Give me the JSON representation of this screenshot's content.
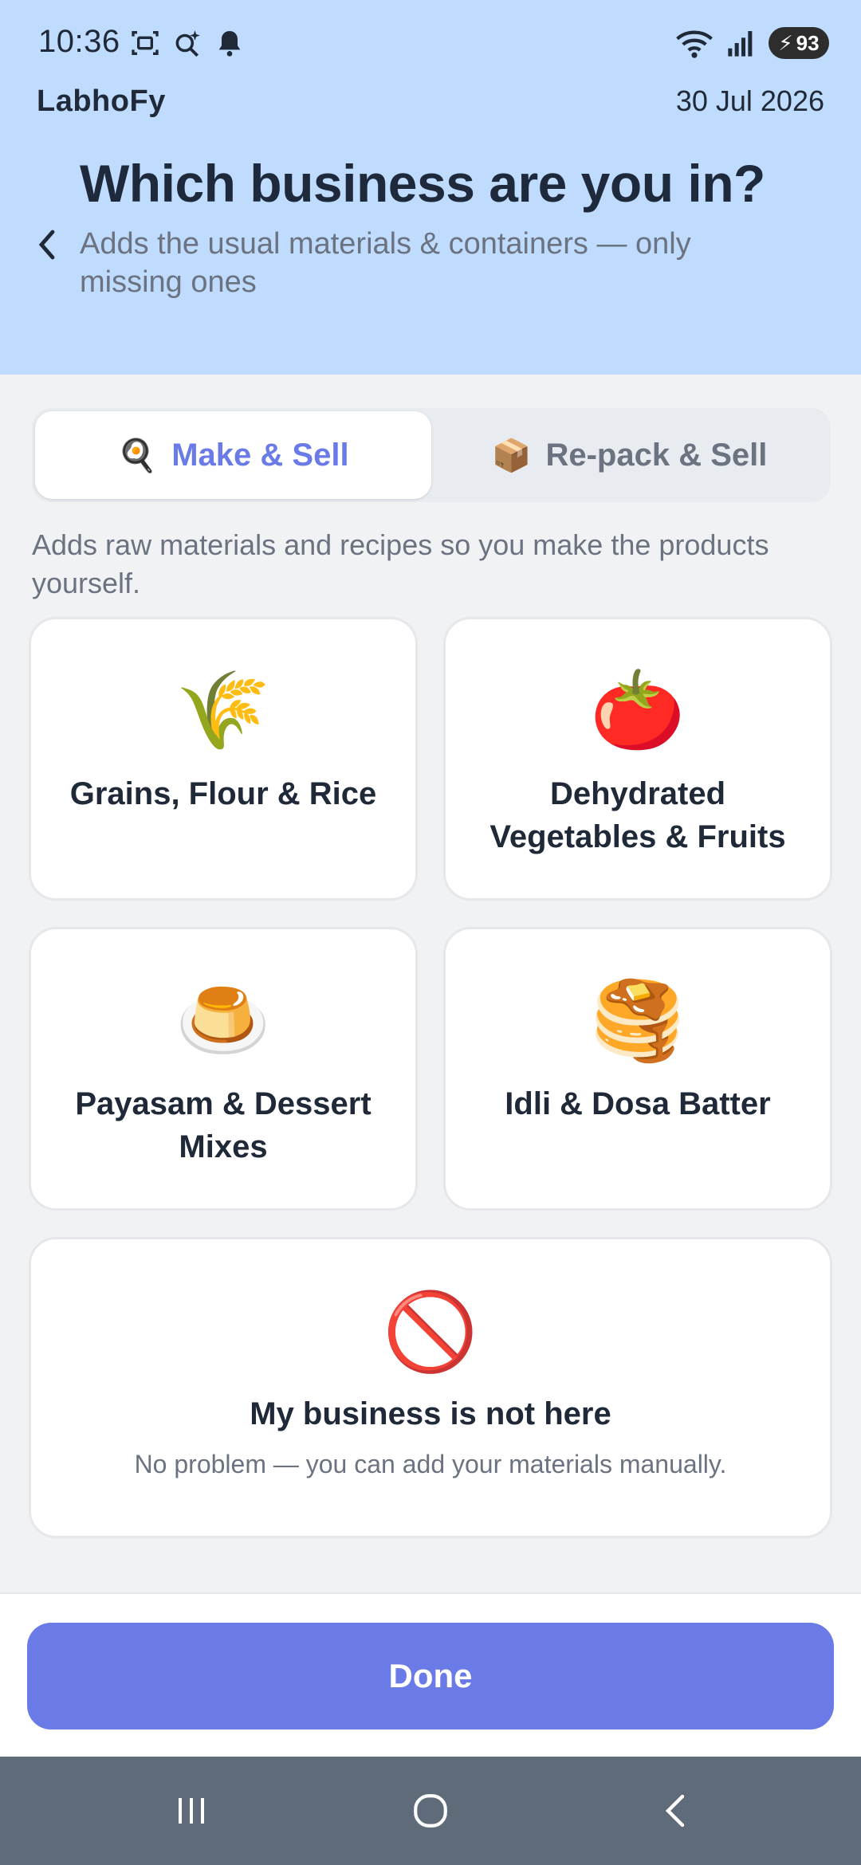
{
  "status_bar": {
    "time": "10:36",
    "battery": "93"
  },
  "header": {
    "app_name": "LabhoFy",
    "date": "30 Jul 2026",
    "title": "Which business are you in?",
    "subtitle": "Adds the usual materials & containers — only missing ones"
  },
  "tabs": [
    {
      "emoji": "🍳",
      "label": "Make & Sell",
      "active": true
    },
    {
      "emoji": "📦",
      "label": "Re-pack & Sell",
      "active": false
    }
  ],
  "helper_text": "Adds raw materials and recipes so you make the products yourself.",
  "categories": [
    {
      "emoji": "🌾",
      "label": "Grains, Flour & Rice"
    },
    {
      "emoji": "🍅",
      "label": "Dehydrated Vegetables & Fruits"
    },
    {
      "emoji": "🍮",
      "label": "Payasam & Dessert Mixes"
    },
    {
      "emoji": "🥞",
      "label": "Idli & Dosa Batter"
    }
  ],
  "not_here": {
    "emoji": "🚫",
    "label": "My business is not here",
    "description": "No problem — you can add your materials manually."
  },
  "actions": {
    "done_label": "Done"
  },
  "colors": {
    "header_bg": "#bfdbfe",
    "accent": "#6a7be7"
  }
}
